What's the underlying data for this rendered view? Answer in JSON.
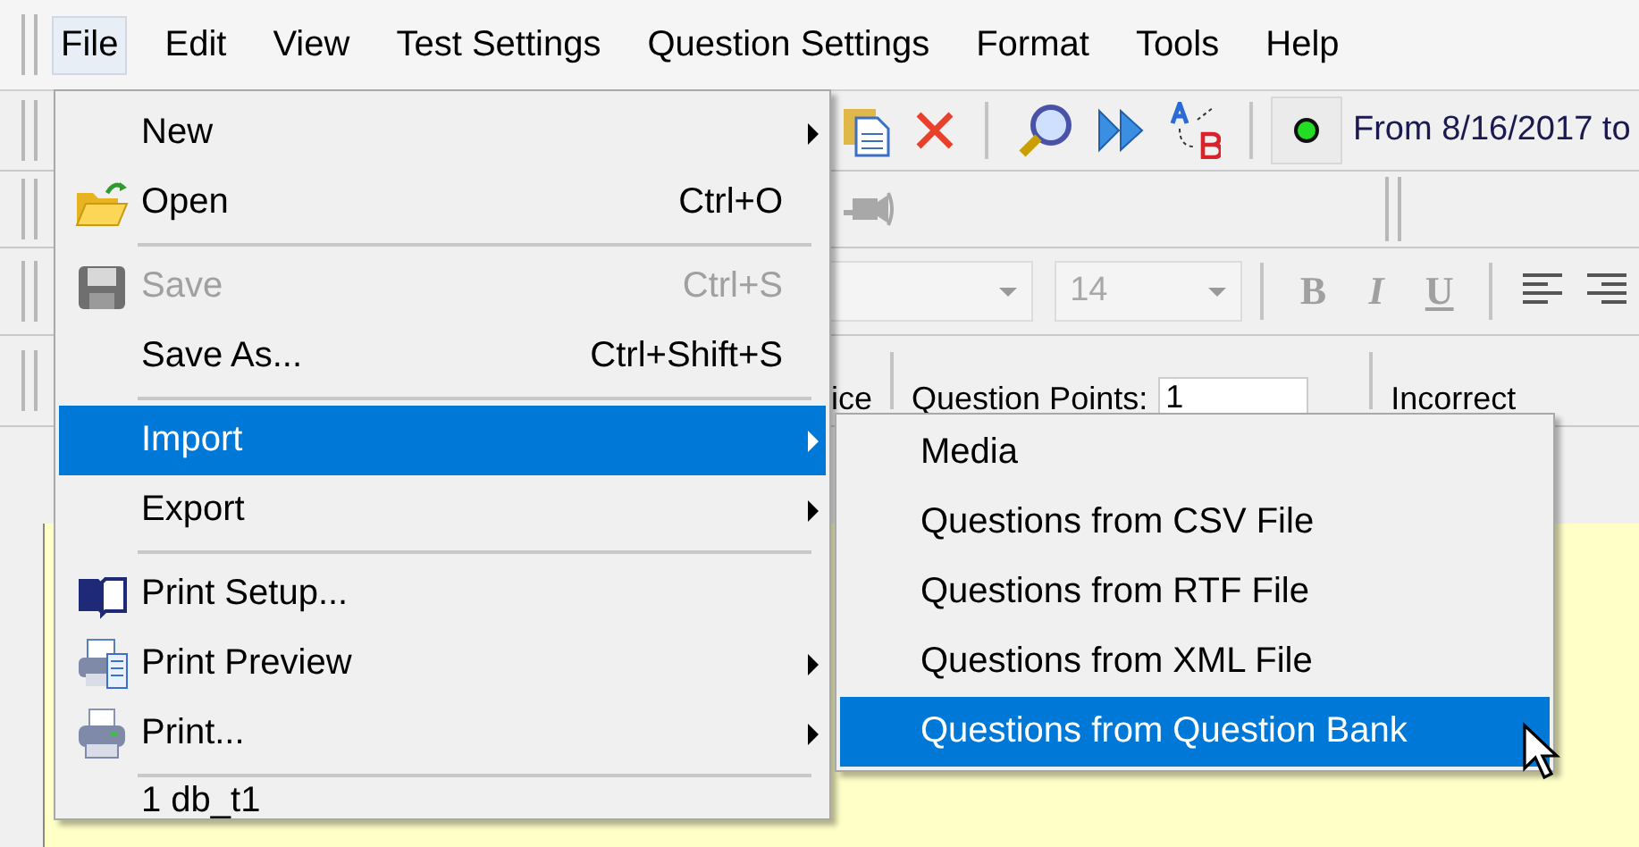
{
  "menu_bar": [
    {
      "label": "File",
      "selected": true
    },
    {
      "label": "Edit",
      "selected": false
    },
    {
      "label": "View",
      "selected": false
    },
    {
      "label": "Test Settings",
      "selected": false
    },
    {
      "label": "Question Settings",
      "selected": false
    },
    {
      "label": "Format",
      "selected": false
    },
    {
      "label": "Tools",
      "selected": false
    },
    {
      "label": "Help",
      "selected": false
    }
  ],
  "toolbar": {
    "status_text": "From 8/16/2017 to"
  },
  "format_bar": {
    "disabled": true,
    "font_size": "14",
    "buttons": [
      {
        "label": "B",
        "kind": "bold"
      },
      {
        "label": "I",
        "kind": "italic"
      },
      {
        "label": "U",
        "kind": "underline"
      }
    ]
  },
  "question_bar": {
    "type_label": "ice",
    "points_label": "Question Points:",
    "points_value": "1",
    "incorrect_label": "Incorrect"
  },
  "file_menu": [
    {
      "kind": "item",
      "label": "New",
      "submenu": true,
      "disabled": false,
      "selected": false
    },
    {
      "kind": "item",
      "label": "Open",
      "shortcut": "Ctrl+O",
      "submenu": false,
      "disabled": false,
      "selected": false
    },
    {
      "kind": "separator"
    },
    {
      "kind": "item",
      "label": "Save",
      "shortcut": "Ctrl+S",
      "submenu": false,
      "disabled": true,
      "selected": false
    },
    {
      "kind": "item",
      "label": "Save As...",
      "shortcut": "Ctrl+Shift+S",
      "submenu": false,
      "disabled": false,
      "selected": false
    },
    {
      "kind": "separator"
    },
    {
      "kind": "item",
      "label": "Import",
      "submenu": true,
      "disabled": false,
      "selected": true
    },
    {
      "kind": "item",
      "label": "Export",
      "submenu": true,
      "disabled": false,
      "selected": false
    },
    {
      "kind": "separator"
    },
    {
      "kind": "item",
      "label": "Print Setup...",
      "submenu": false,
      "disabled": false,
      "selected": false
    },
    {
      "kind": "item",
      "label": "Print Preview",
      "submenu": true,
      "disabled": false,
      "selected": false
    },
    {
      "kind": "item",
      "label": "Print...",
      "submenu": true,
      "disabled": false,
      "selected": false
    },
    {
      "kind": "separator"
    },
    {
      "kind": "recent",
      "label": "1 db_t1"
    }
  ],
  "import_submenu": [
    {
      "label": "Media",
      "selected": false
    },
    {
      "label": "Questions from CSV File",
      "selected": false
    },
    {
      "label": "Questions from RTF File",
      "selected": false
    },
    {
      "label": "Questions from XML File",
      "selected": false
    },
    {
      "label": "Questions from Question Bank",
      "selected": true
    }
  ]
}
